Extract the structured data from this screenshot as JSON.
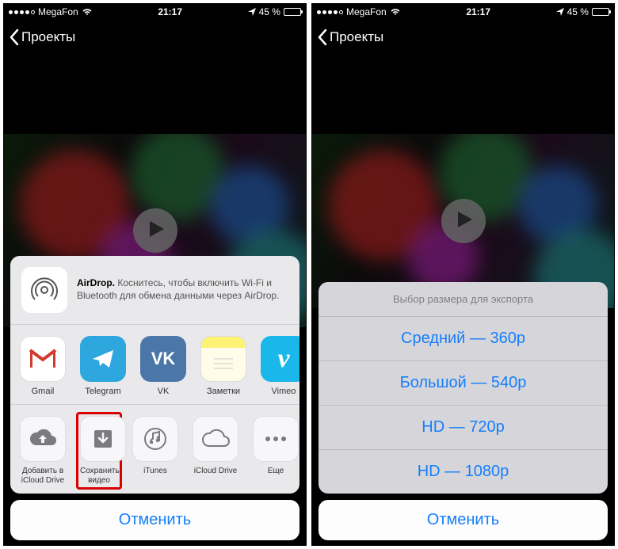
{
  "status": {
    "carrier": "MegaFon",
    "time": "21:17",
    "battery_pct": "45 %"
  },
  "nav": {
    "back_label": "Проекты"
  },
  "share_sheet": {
    "airdrop_title": "AirDrop.",
    "airdrop_desc": "Коснитесь, чтобы включить Wi-Fi и Bluetooth для обмена данными через AirDrop.",
    "apps": [
      {
        "label": "Gmail",
        "icon": "gmail-icon"
      },
      {
        "label": "Telegram",
        "icon": "telegram-icon"
      },
      {
        "label": "VK",
        "icon": "vk-icon"
      },
      {
        "label": "Заметки",
        "icon": "notes-icon"
      },
      {
        "label": "Vimeo",
        "icon": "vimeo-icon"
      }
    ],
    "actions": [
      {
        "label_l1": "Добавить в",
        "label_l2": "iCloud Drive",
        "icon": "cloud-upload-icon"
      },
      {
        "label_l1": "Сохранить",
        "label_l2": "видео",
        "icon": "save-video-icon",
        "highlight": true
      },
      {
        "label_l1": "iTunes",
        "label_l2": "",
        "icon": "itunes-icon"
      },
      {
        "label_l1": "iCloud Drive",
        "label_l2": "",
        "icon": "icloud-icon"
      },
      {
        "label_l1": "Еще",
        "label_l2": "",
        "icon": "more-icon"
      }
    ],
    "cancel": "Отменить"
  },
  "export_sheet": {
    "title": "Выбор размера для экспорта",
    "options": [
      "Средний — 360p",
      "Большой — 540p",
      "HD — 720p",
      "HD — 1080p"
    ],
    "cancel": "Отменить"
  }
}
